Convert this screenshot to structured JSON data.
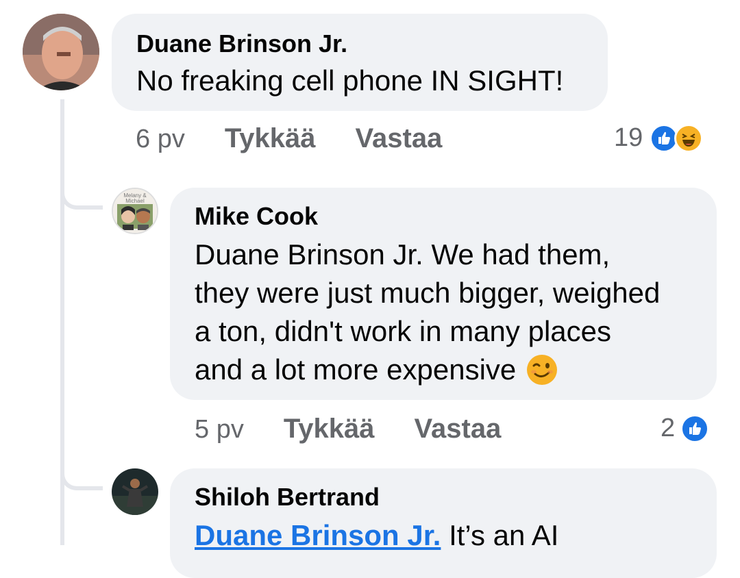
{
  "colors": {
    "bubble_bg": "#f0f2f5",
    "meta_text": "#65676b",
    "like_blue": "#1b74e4",
    "haha_yellow": "#f7b125",
    "thread_line": "#e4e6eb"
  },
  "comments": [
    {
      "author": "Duane Brinson Jr.",
      "text": "No freaking cell phone IN SIGHT!",
      "time": "6 pv",
      "like_label": "Tykkää",
      "reply_label": "Vastaa",
      "reaction_count": "19",
      "reaction_icons": [
        "like-icon",
        "haha-icon"
      ]
    },
    {
      "author": "Mike Cook",
      "text_lines": [
        "Duane Brinson Jr. We had them,",
        "they were just much bigger, weighed",
        "a ton, didn't work in many places",
        "and a lot more expensive"
      ],
      "emoji": "wink-emoji",
      "avatar_caption": "Melany & Michael",
      "time": "5 pv",
      "like_label": "Tykkää",
      "reply_label": "Vastaa",
      "reaction_count": "2",
      "reaction_icons": [
        "like-icon"
      ]
    },
    {
      "author": "Shiloh Bertrand",
      "mention": "Duane Brinson Jr.",
      "text_fragment": "It’s an AI"
    }
  ]
}
